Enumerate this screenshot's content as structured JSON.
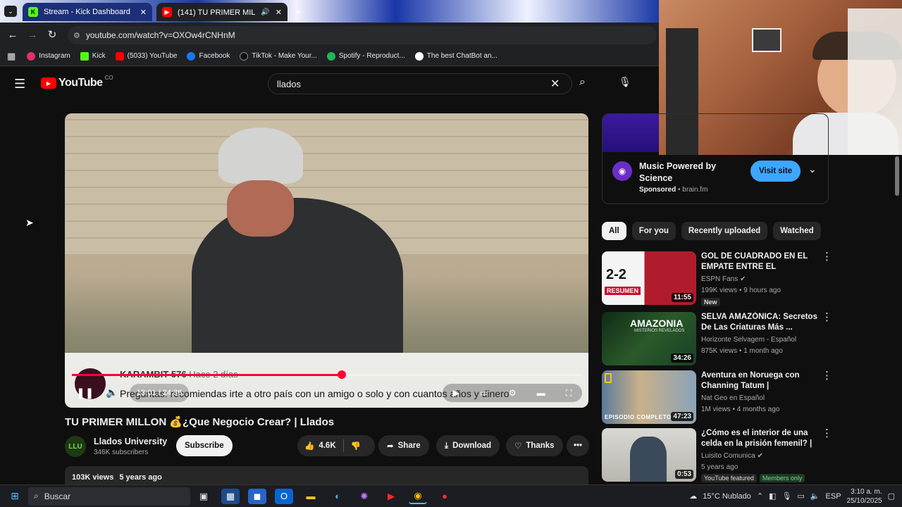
{
  "browser": {
    "tabs": [
      {
        "label": "Stream - Kick Dashboard"
      },
      {
        "label": "(141) TU PRIMER MILLON 💰"
      }
    ],
    "url": "youtube.com/watch?v=OXOw4rCNHnM",
    "bookmarks": [
      {
        "label": "Instagram",
        "color": "#e1306c"
      },
      {
        "label": "Kick",
        "color": "#53fc18"
      },
      {
        "label": "(5033) YouTube",
        "color": "#ff0000"
      },
      {
        "label": "Facebook",
        "color": "#1877f2"
      },
      {
        "label": "TikTok - Make Your...",
        "color": "#111111"
      },
      {
        "label": "Spotify - Reproduct...",
        "color": "#1db954"
      },
      {
        "label": "The best ChatBot an...",
        "color": "#ffffff"
      }
    ]
  },
  "youtube": {
    "logo": "YouTube",
    "country": "CO",
    "search_value": "llados",
    "player": {
      "overlay_user": "KARAMBIT 576",
      "overlay_time": "Hace 2 días",
      "overlay_comment": "Preguntas: recomiendas irte a otro país con un amigo o solo y con cuantos años y dinero",
      "time": "13:01 / 24:36",
      "progress_fraction": 0.53
    },
    "video_title": "TU PRIMER MILLON 💰¿Que Negocio Crear? | Llados",
    "channel": {
      "name": "Llados University",
      "subscribers": "346K subscribers",
      "avatar_text": "LLU"
    },
    "subscribe_label": "Subscribe",
    "likes": "4.6K",
    "share_label": "Share",
    "download_label": "Download",
    "thanks_label": "Thanks",
    "views": "103K views",
    "age": "5 years ago"
  },
  "ad": {
    "title": "Music Powered by Science",
    "sponsored": "Sponsored",
    "domain": "brain.fm",
    "cta": "Visit site"
  },
  "chips": [
    "All",
    "For you",
    "Recently uploaded",
    "Watched"
  ],
  "recommendations": [
    {
      "title": "GOL DE CUADRADO EN EL EMPATE ENTRE EL ROSSONE...",
      "channel": "ESPN Fans",
      "meta": "199K views • 9 hours ago",
      "badge": "New",
      "duration": "11:55",
      "thumb_text": "2-2",
      "thumb_sub": "RESUMEN"
    },
    {
      "title": "SELVA AMAZÓNICA: Secretos De Las Criaturas Más ...",
      "channel": "Horizonte Selvagem - Español",
      "meta": "875K views • 1 month ago",
      "badge": "",
      "duration": "34:26",
      "thumb_text": "AMAZONIA",
      "thumb_sub": "MISTERIOS REVELADOS"
    },
    {
      "title": "Aventura en Noruega con Channing Tatum | Salvajament...",
      "channel": "Nat Geo en Español",
      "meta": "1M views • 4 months ago",
      "badge": "",
      "duration": "47:23",
      "thumb_text": "",
      "thumb_sub": "EPISODIO COMPLETO"
    },
    {
      "title": "¿Cómo es el interior de una celda en la prisión femenil? | ...",
      "channel": "Luisito Comunica",
      "meta": "5 years ago",
      "badge": "YouTube featured",
      "badge2": "Members only",
      "duration": "0:53",
      "thumb_text": "",
      "thumb_sub": ""
    }
  ],
  "taskbar": {
    "search_placeholder": "Buscar",
    "weather": "15°C  Nublado",
    "lang": "ESP",
    "time": "3:10 a. m.",
    "date": "25/10/2025",
    "notif_count": "2"
  }
}
